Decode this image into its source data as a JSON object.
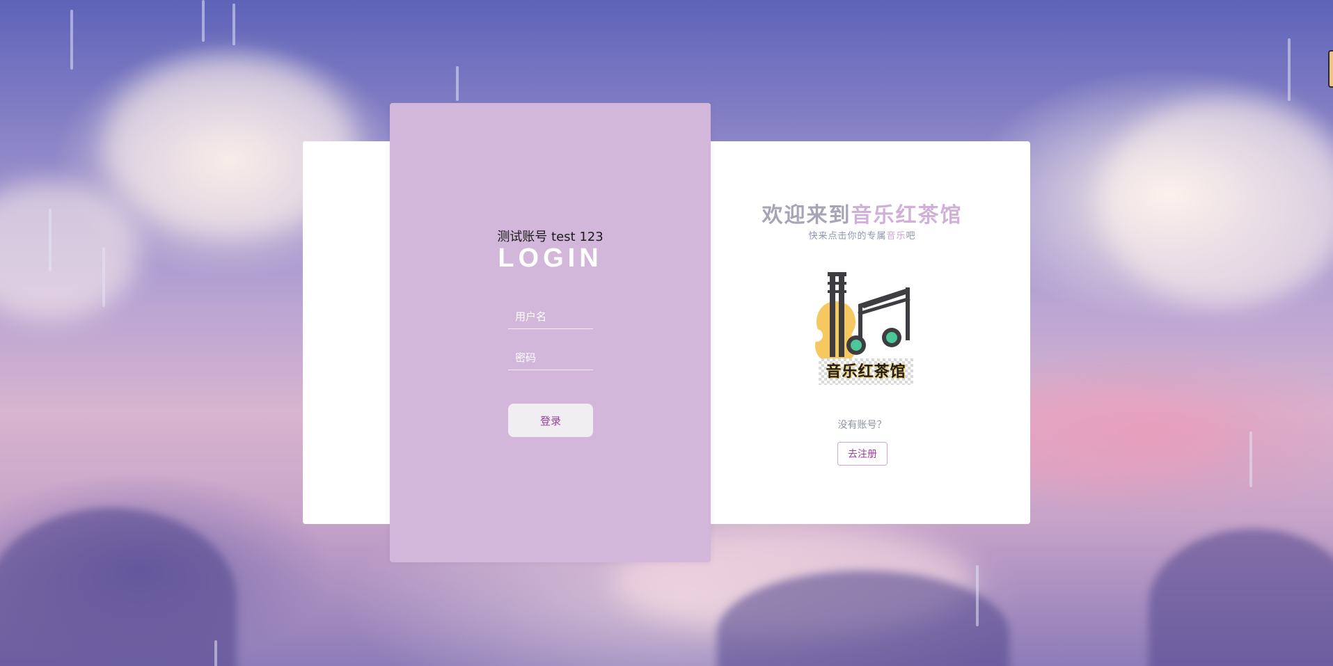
{
  "login": {
    "tip": "测试账号 test 123",
    "title": "LOGIN",
    "username_placeholder": "用户名",
    "password_placeholder": "密码",
    "submit_label": "登录"
  },
  "welcome": {
    "title_prefix": "欢迎来到",
    "title_accent": "音乐红茶馆",
    "subtitle_prefix": "快来点击你的专属",
    "subtitle_accent": "音乐",
    "subtitle_suffix": "吧",
    "logo_text": "音乐红茶馆",
    "logo_icon": "violin-music-note-icon"
  },
  "register": {
    "prompt": "没有账号？",
    "button_label": "去注册"
  },
  "colors": {
    "login_panel": "#d3b7da",
    "accent_purple": "#9b3f9c",
    "title_gray": "#a7a4b7",
    "title_accent": "#d0b0d8",
    "logo_yellow": "#f5c861",
    "logo_green": "#4cc79a",
    "logo_dark": "#3e3e42"
  }
}
